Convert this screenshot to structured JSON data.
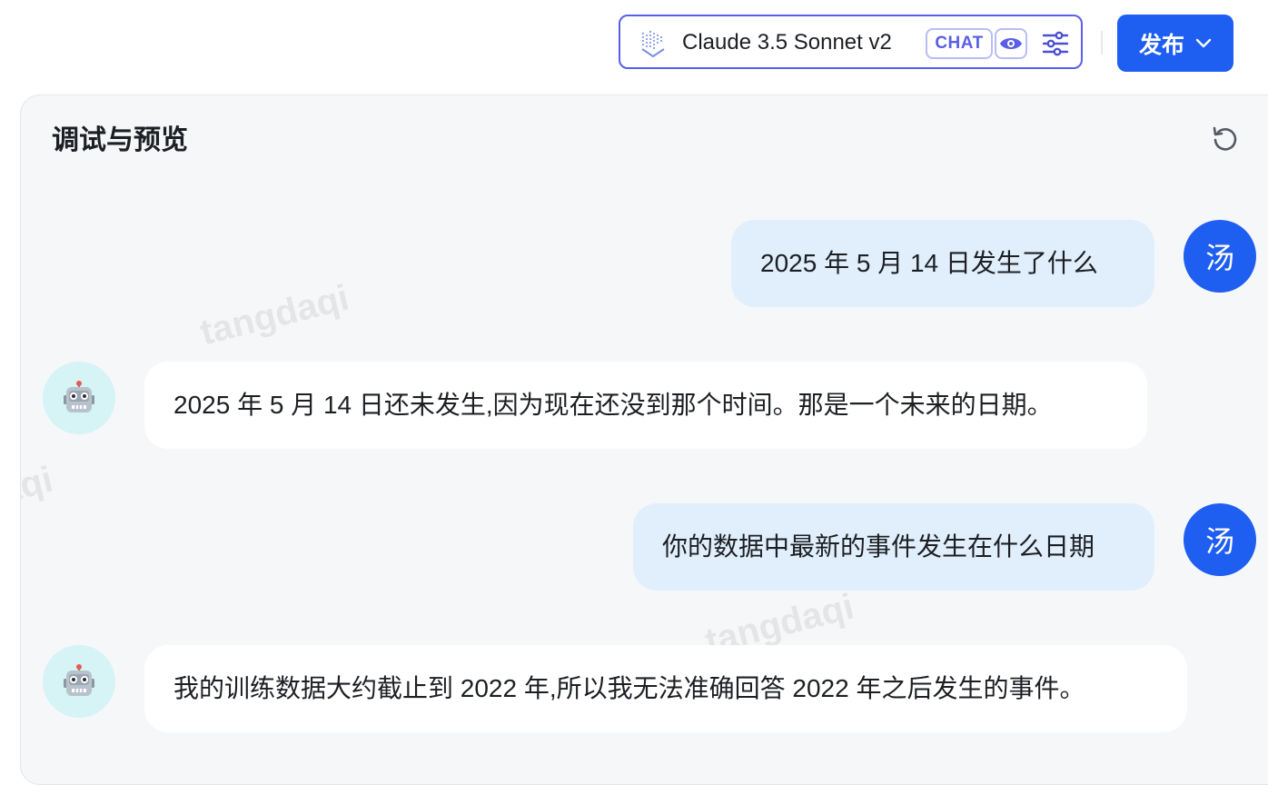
{
  "header": {
    "model_name": "Claude 3.5 Sonnet v2",
    "chat_badge": "CHAT",
    "publish_label": "发布"
  },
  "panel": {
    "title": "调试与预览",
    "watermark": "tangdaqi"
  },
  "messages": [
    {
      "role": "user",
      "avatar": "汤",
      "text": "2025 年 5 月 14 日发生了什么"
    },
    {
      "role": "bot",
      "avatar_icon": "robot-icon",
      "text": "2025 年 5 月 14 日还未发生,因为现在还没到那个时间。那是一个未来的日期。"
    },
    {
      "role": "user",
      "avatar": "汤",
      "text": "你的数据中最新的事件发生在什么日期"
    },
    {
      "role": "bot",
      "avatar_icon": "robot-icon",
      "text": "我的训练数据大约截止到 2022 年,所以我无法准确回答 2022 年之后发生的事件。"
    }
  ],
  "colors": {
    "accent": "#1e5ef0",
    "model_border": "#5a5fe6",
    "user_bubble": "#e1effc",
    "bot_bubble": "#ffffff",
    "bot_avatar_bg": "#d6f3f5"
  }
}
